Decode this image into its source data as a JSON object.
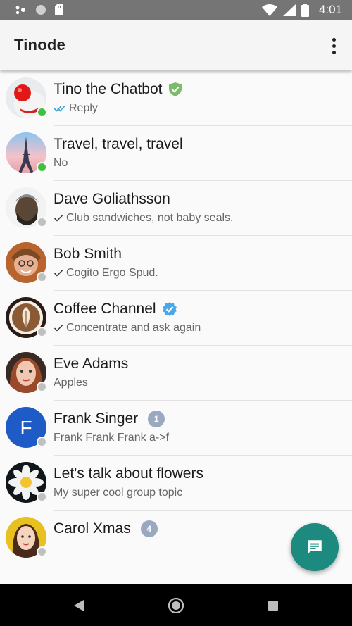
{
  "status_bar": {
    "time": "4:01"
  },
  "app_bar": {
    "title": "Tinode"
  },
  "contacts": [
    {
      "name": "Tino the Chatbot",
      "preview": "Reply",
      "receipt": "read",
      "verified": "green",
      "online": true,
      "badge": ""
    },
    {
      "name": "Travel, travel, travel",
      "preview": "No",
      "receipt": "",
      "verified": "",
      "online": true,
      "badge": ""
    },
    {
      "name": "Dave Goliathsson",
      "preview": "Club sandwiches, not baby seals.",
      "receipt": "sent",
      "verified": "",
      "online": false,
      "badge": ""
    },
    {
      "name": "Bob Smith",
      "preview": "Cogito Ergo Spud.",
      "receipt": "sent",
      "verified": "",
      "online": false,
      "badge": ""
    },
    {
      "name": "Coffee Channel",
      "preview": "Concentrate and ask again",
      "receipt": "sent",
      "verified": "blue",
      "online": false,
      "badge": ""
    },
    {
      "name": "Eve Adams",
      "preview": "Apples",
      "receipt": "",
      "verified": "",
      "online": false,
      "badge": ""
    },
    {
      "name": "Frank Singer",
      "preview": "Frank Frank Frank a->f",
      "receipt": "",
      "verified": "",
      "online": false,
      "badge": "1",
      "avatar_letter": "F"
    },
    {
      "name": "Let's talk about flowers",
      "preview": "My super cool group topic",
      "receipt": "",
      "verified": "",
      "online": false,
      "badge": ""
    },
    {
      "name": "Carol Xmas",
      "preview": "",
      "receipt": "",
      "verified": "",
      "online": false,
      "badge": "4"
    }
  ],
  "colors": {
    "accent": "#1c8a7e",
    "online": "#40c040",
    "offline": "#c0c0c0",
    "badge": "#9aa8c0",
    "status_bar": "#757575"
  },
  "icons": {
    "fab": "new-chat-icon",
    "menu": "more-vert-icon"
  }
}
